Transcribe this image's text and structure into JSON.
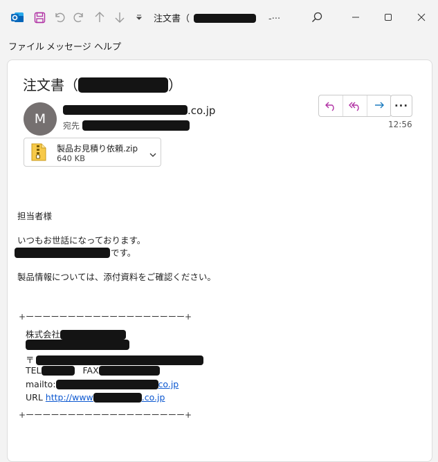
{
  "window": {
    "title_prefix": "注文書（",
    "title_suffix": "-···"
  },
  "menu": {
    "file": "ファイル",
    "message": "メッセージ",
    "help": "ヘルプ"
  },
  "email": {
    "subject_prefix": "注文書（",
    "subject_suffix": "）",
    "sender_avatar": "M",
    "sender_domain": ".co.jp",
    "to_label": "宛先",
    "time": "12:56",
    "attachment": {
      "name": "製品お見積り依頼.zip",
      "size": "640 KB"
    }
  },
  "body": {
    "greeting": "担当者様",
    "line1": "いつもお世話になっております。",
    "line2_suffix": "です。",
    "line3": "製品情報については、添付資料をご確認ください。"
  },
  "signature": {
    "border": "+ーーーーーーーーーーーーーーーーーーー+",
    "company_prefix": "株式会社",
    "postal_mark": "〒",
    "tel_label": "TEL",
    "fax_label": "FAX",
    "mailto_label": "mailto:",
    "mail_suffix": "co.jp",
    "url_label": "URL",
    "url_prefix": "http://www",
    "url_suffix": ".co.jp"
  },
  "icons": {
    "app": "outlook-icon",
    "save": "save-icon",
    "undo": "undo-icon",
    "redo": "redo-icon",
    "up": "arrow-up-icon",
    "down": "arrow-down-icon",
    "search": "search-icon",
    "minimize": "minimize-icon",
    "maximize": "maximize-icon",
    "close": "close-icon",
    "reply": "reply-icon",
    "reply_all": "reply-all-icon",
    "forward": "forward-icon",
    "more": "more-icon",
    "attachment": "zip-file-icon",
    "chevron": "chevron-down-icon"
  },
  "colors": {
    "accent_reply": "#b02fa3",
    "accent_forward": "#1b7bbf",
    "link": "#0b57d0",
    "avatar_bg": "#757070"
  }
}
